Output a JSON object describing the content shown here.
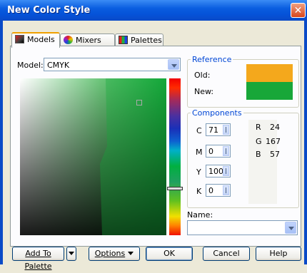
{
  "window": {
    "title": "New Color Style",
    "close_glyph": "✕"
  },
  "tabs": [
    {
      "label": "Models",
      "icon": "models-icon"
    },
    {
      "label": "Mixers",
      "icon": "mixers-icon"
    },
    {
      "label": "Palettes",
      "icon": "palettes-icon"
    }
  ],
  "model": {
    "label": "Model:",
    "value": "CMYK"
  },
  "reference": {
    "legend": "Reference",
    "old_label": "Old:",
    "old_color": "#f4a81c",
    "new_label": "New:",
    "new_color": "#18a739"
  },
  "components": {
    "legend": "Components",
    "cmyk": [
      {
        "label": "C",
        "value": "71"
      },
      {
        "label": "M",
        "value": "0"
      },
      {
        "label": "Y",
        "value": "100"
      },
      {
        "label": "K",
        "value": "0"
      }
    ],
    "rgb": [
      {
        "label": "R",
        "value": "24"
      },
      {
        "label": "G",
        "value": "167"
      },
      {
        "label": "B",
        "value": "57"
      }
    ]
  },
  "name": {
    "label": "Name:",
    "value": ""
  },
  "buttons": {
    "add_to_palette": "Add To Palette",
    "options": "Options",
    "ok": "OK",
    "cancel": "Cancel",
    "help": "Help"
  },
  "colors": {
    "accent_blue": "#0046d5",
    "titlebar": "#0a5ee0"
  }
}
